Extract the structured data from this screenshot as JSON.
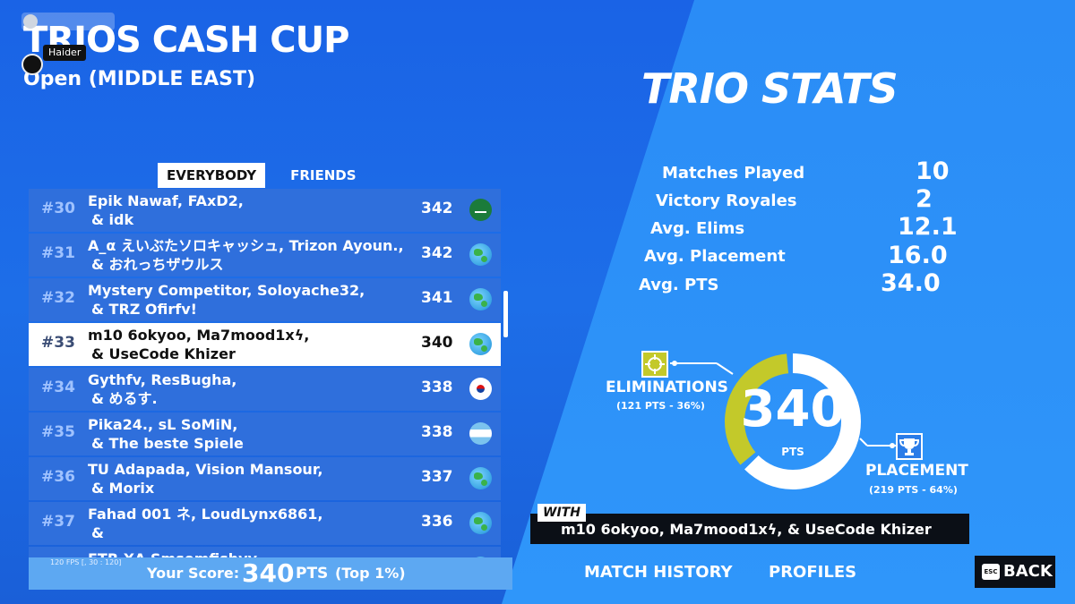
{
  "header": {
    "title": "TRIOS CASH CUP",
    "subtitle": "Open (MIDDLE EAST)",
    "user_name": "Haider"
  },
  "tabs": [
    {
      "label": "EVERYBODY",
      "active": true
    },
    {
      "label": "FRIENDS",
      "active": false
    }
  ],
  "leaderboard": [
    {
      "rank": "#30",
      "line1": "Epik Nawaf, FAxD2,",
      "line2": "& idk",
      "score": "342",
      "flag": "sa"
    },
    {
      "rank": "#31",
      "line1": "A_α えいぶたソロキャッシュ, Trizon Ayoun.,",
      "line2": "& おれっちザウルス",
      "score": "342",
      "flag": "globe"
    },
    {
      "rank": "#32",
      "line1": "Mystery Competitor, Soloyache32,",
      "line2": "& TRZ Ofirfv!",
      "score": "341",
      "flag": "globe"
    },
    {
      "rank": "#33",
      "line1": "m10 6okyoo, Ma7mood1xϟ,",
      "line2": "& UseCode Khizer",
      "score": "340",
      "flag": "globe",
      "me": true
    },
    {
      "rank": "#34",
      "line1": "Gythfv, ResBugha,",
      "line2": "& めるす.",
      "score": "338",
      "flag": "kr"
    },
    {
      "rank": "#35",
      "line1": "Pika24., sL SoMiN,",
      "line2": "& The beste Spiele",
      "score": "338",
      "flag": "ar"
    },
    {
      "rank": "#36",
      "line1": "TU Adapada, Vision Mansour,",
      "line2": "& Morix",
      "score": "337",
      "flag": "globe"
    },
    {
      "rank": "#37",
      "line1": "Fahad 001 ネ, LoudLynx6861,",
      "line2": "&",
      "score": "336",
      "flag": "globe"
    },
    {
      "rank": "",
      "line1": "FTR XA Smsomfishyy",
      "line2": "",
      "score": "",
      "flag": "globe"
    }
  ],
  "score_bar": {
    "fps": "120 FPS [, 30 : 120]",
    "label": "Your Score:",
    "value": "340",
    "unit": "PTS",
    "top": "(Top 1%)"
  },
  "stats": {
    "title": "TRIO STATS",
    "items": [
      {
        "label": "Matches Played",
        "value": "10"
      },
      {
        "label": "Victory Royales",
        "value": "2"
      },
      {
        "label": "Avg. Elims",
        "value": "12.1"
      },
      {
        "label": "Avg. Placement",
        "value": "16.0"
      },
      {
        "label": "Avg. PTS",
        "value": "34.0"
      }
    ]
  },
  "breakdown": {
    "total": "340",
    "unit": "PTS",
    "elim_fraction": 0.36,
    "eliminations_label": "ELIMINATIONS",
    "eliminations_sub": "(121 PTS - 36%)",
    "placement_label": "PLACEMENT",
    "placement_sub": "(219 PTS - 64%)",
    "elim_color": "#c3c92a",
    "placement_color": "#ffffff"
  },
  "with": {
    "label": "WITH",
    "names": "m10 6okyoo, Ma7mood1xϟ, & UseCode Khizer"
  },
  "nav": {
    "match_history": "MATCH HISTORY",
    "profiles": "PROFILES",
    "back_key": "ESC",
    "back_label": "BACK"
  }
}
